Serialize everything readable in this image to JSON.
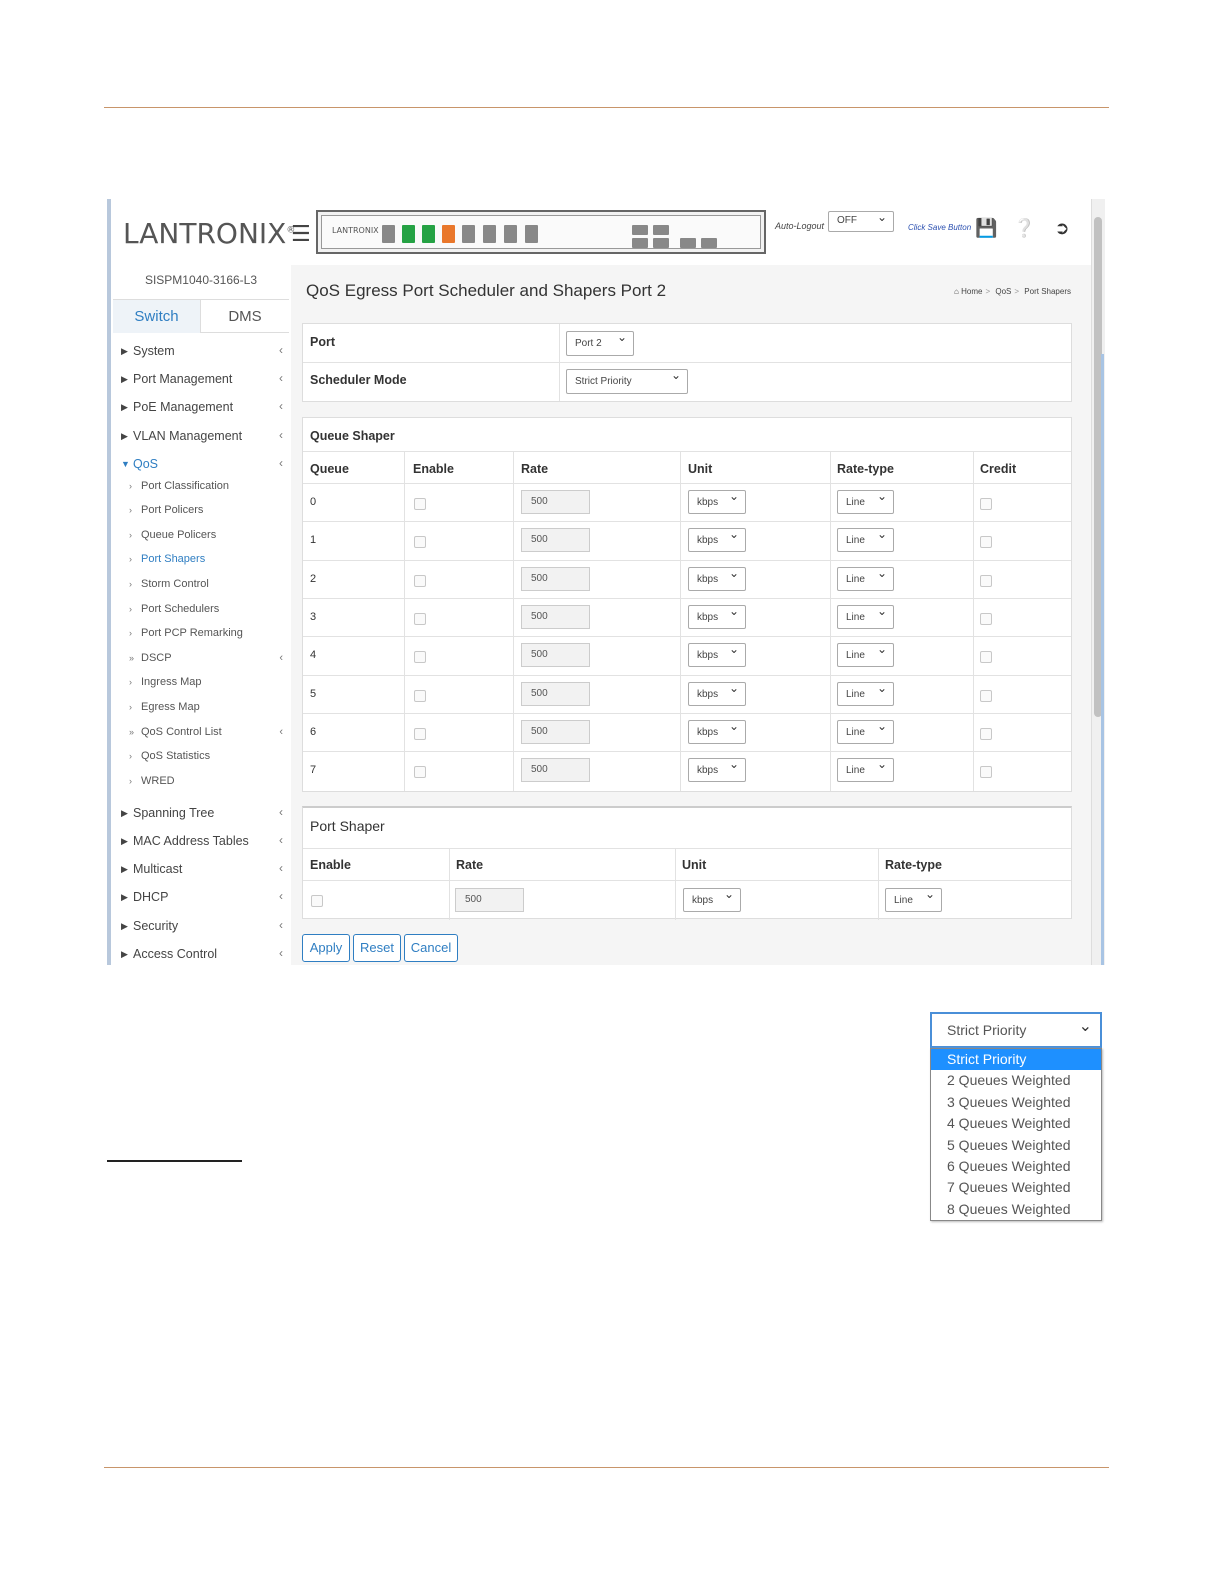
{
  "header": {
    "logo_text": "LANTRONIX",
    "panel_logo": "LANTRONIX",
    "auto_logout_label": "Auto-Logout",
    "auto_logout_value": "OFF",
    "click_save_label": "Click Save Button",
    "icons": [
      "save-icon",
      "help-icon",
      "logout-icon"
    ]
  },
  "sidebar": {
    "model": "SISPM1040-3166-L3",
    "tabs": [
      "Switch",
      "DMS"
    ],
    "menu_top": [
      "System",
      "Port Management",
      "PoE Management",
      "VLAN Management"
    ],
    "qos_label": "QoS",
    "qos_items": [
      "Port Classification",
      "Port Policers",
      "Queue Policers",
      "Port Shapers",
      "Storm Control",
      "Port Schedulers",
      "Port PCP Remarking",
      "DSCP",
      "Ingress Map",
      "Egress Map",
      "QoS Control List",
      "QoS Statistics",
      "WRED"
    ],
    "menu_bottom": [
      "Spanning Tree",
      "MAC Address Tables",
      "Multicast",
      "DHCP",
      "Security",
      "Access Control"
    ]
  },
  "main": {
    "title": "QoS Egress Port Scheduler and Shapers  Port 2",
    "breadcrumb": [
      "Home",
      "QoS",
      "Port Shapers"
    ],
    "port_label": "Port",
    "port_value": "Port 2",
    "scheduler_mode_label": "Scheduler Mode",
    "scheduler_mode_value": "Strict Priority",
    "queue_shaper": {
      "title": "Queue Shaper",
      "headers": [
        "Queue",
        "Enable",
        "Rate",
        "Unit",
        "Rate-type",
        "Credit"
      ],
      "rows": [
        {
          "queue": "0",
          "rate": "500",
          "unit": "kbps",
          "rate_type": "Line"
        },
        {
          "queue": "1",
          "rate": "500",
          "unit": "kbps",
          "rate_type": "Line"
        },
        {
          "queue": "2",
          "rate": "500",
          "unit": "kbps",
          "rate_type": "Line"
        },
        {
          "queue": "3",
          "rate": "500",
          "unit": "kbps",
          "rate_type": "Line"
        },
        {
          "queue": "4",
          "rate": "500",
          "unit": "kbps",
          "rate_type": "Line"
        },
        {
          "queue": "5",
          "rate": "500",
          "unit": "kbps",
          "rate_type": "Line"
        },
        {
          "queue": "6",
          "rate": "500",
          "unit": "kbps",
          "rate_type": "Line"
        },
        {
          "queue": "7",
          "rate": "500",
          "unit": "kbps",
          "rate_type": "Line"
        }
      ]
    },
    "port_shaper": {
      "title": "Port Shaper",
      "headers": [
        "Enable",
        "Rate",
        "Unit",
        "Rate-type"
      ],
      "rate": "500",
      "unit": "kbps",
      "rate_type": "Line"
    },
    "buttons": {
      "apply": "Apply",
      "reset": "Reset",
      "cancel": "Cancel"
    }
  },
  "dropdown": {
    "selected": "Strict Priority",
    "options": [
      "Strict Priority",
      "2 Queues Weighted",
      "3 Queues Weighted",
      "4 Queues Weighted",
      "5 Queues Weighted",
      "6 Queues Weighted",
      "7 Queues Weighted",
      "8 Queues Weighted"
    ]
  }
}
